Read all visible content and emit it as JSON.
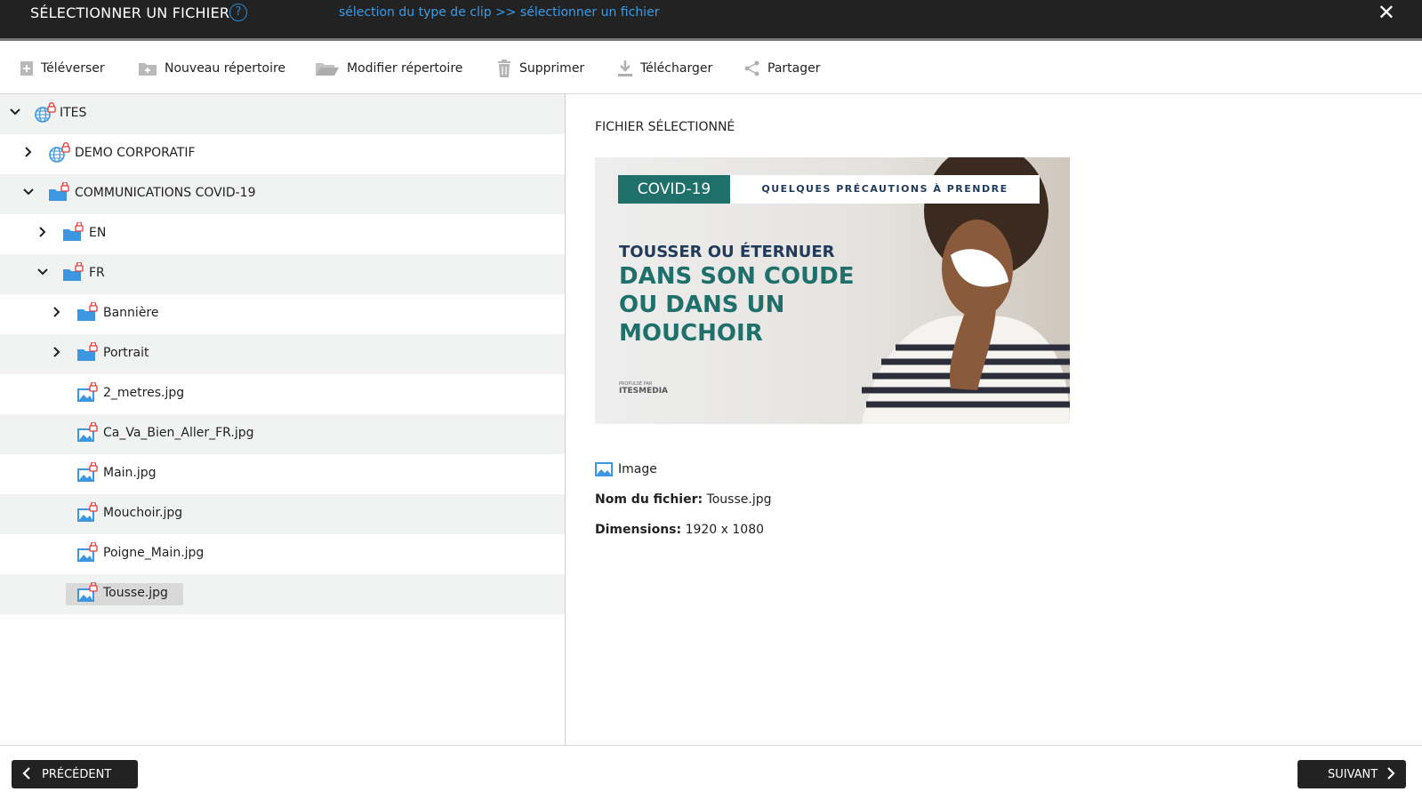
{
  "header": {
    "title": "SÉLECTIONNER UN FICHIER",
    "help_glyph": "?",
    "breadcrumb": "sélection du type de clip >> sélectionner un fichier",
    "close_glyph": "✕"
  },
  "toolbar": {
    "upload": "Téléverser",
    "new_dir": "Nouveau répertoire",
    "edit_dir": "Modifier répertoire",
    "delete": "Supprimer",
    "download": "Télécharger",
    "share": "Partager"
  },
  "tree": {
    "items": [
      {
        "label": "ITES",
        "type": "globe",
        "expanded": true
      },
      {
        "label": "DEMO CORPORATIF",
        "type": "globe",
        "expanded": false
      },
      {
        "label": "COMMUNICATIONS COVID-19",
        "type": "folder",
        "expanded": true
      },
      {
        "label": "EN",
        "type": "folder",
        "expanded": false
      },
      {
        "label": "FR",
        "type": "folder",
        "expanded": true
      },
      {
        "label": "Bannière",
        "type": "folder",
        "expanded": false
      },
      {
        "label": "Portrait",
        "type": "folder",
        "expanded": false
      },
      {
        "label": "2_metres.jpg",
        "type": "image"
      },
      {
        "label": "Ca_Va_Bien_Aller_FR.jpg",
        "type": "image"
      },
      {
        "label": "Main.jpg",
        "type": "image"
      },
      {
        "label": "Mouchoir.jpg",
        "type": "image"
      },
      {
        "label": "Poigne_Main.jpg",
        "type": "image"
      },
      {
        "label": "Tousse.jpg",
        "type": "image",
        "selected": true
      }
    ]
  },
  "preview": {
    "title": "FICHIER SÉLECTIONNÉ",
    "image": {
      "tag": "COVID-19",
      "banner": "QUELQUES PRÉCAUTIONS À PRENDRE",
      "headline_1": "TOUSSER OU ÉTERNUER",
      "headline_2": "DANS SON COUDE",
      "headline_3": "OU DANS UN",
      "headline_4": "MOUCHOIR",
      "credit_small": "PROPULSÉ PAR",
      "credit_logo": "ITESMEDIA"
    },
    "type_label": "Image",
    "filename_label": "Nom du fichier:",
    "filename_value": "Tousse.jpg",
    "dimensions_label": "Dimensions:",
    "dimensions_value": "1920 x 1080"
  },
  "footer": {
    "prev": "PRÉCÉDENT",
    "next": "SUIVANT"
  },
  "colors": {
    "header_bg": "#222222",
    "link_blue": "#3a9de8",
    "folder_blue": "#3c96e0",
    "lock_red": "#e03a3a",
    "teal": "#1f6f6a",
    "alt_row": "#f1f2f2"
  }
}
